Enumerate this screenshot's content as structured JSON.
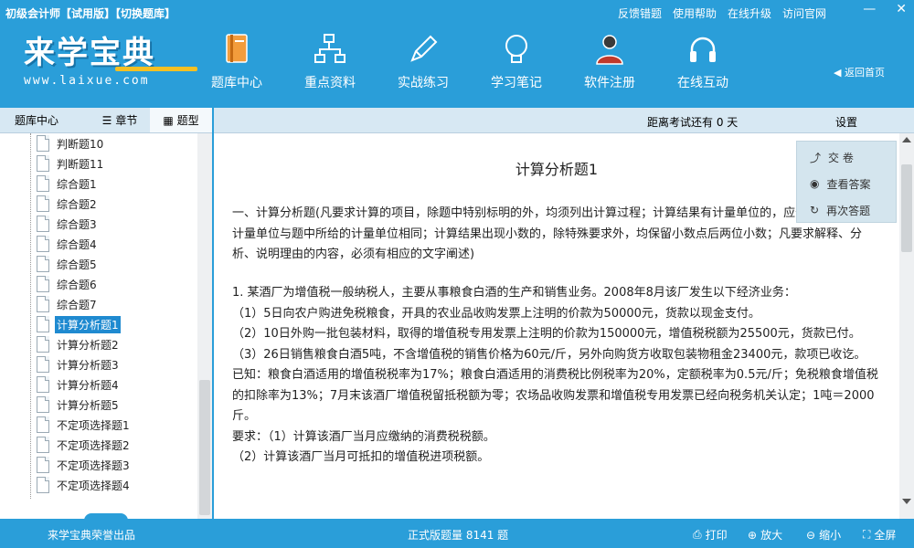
{
  "app": {
    "title": "初级会计师【试用版】【切换题库】"
  },
  "top_links": [
    "反馈错题",
    "使用帮助",
    "在线升级",
    "访问官网"
  ],
  "window_controls": {
    "minimize": "—",
    "close": "✕"
  },
  "logo": {
    "main": "来学宝典",
    "sub": "www.laixue.com"
  },
  "nav": [
    {
      "label": "题库中心",
      "icon": "book-icon"
    },
    {
      "label": "重点资料",
      "icon": "network-icon"
    },
    {
      "label": "实战练习",
      "icon": "pencil-icon"
    },
    {
      "label": "学习笔记",
      "icon": "lightbulb-icon"
    },
    {
      "label": "软件注册",
      "icon": "user-icon"
    },
    {
      "label": "在线互动",
      "icon": "headphones-icon"
    }
  ],
  "back_home": "返回首页",
  "left_tabs": {
    "bank": "题库中心",
    "chapter": "章节",
    "type": "题型"
  },
  "tree_items": [
    "判断题10",
    "判断题11",
    "综合题1",
    "综合题2",
    "综合题3",
    "综合题4",
    "综合题5",
    "综合题6",
    "综合题7",
    "计算分析题1",
    "计算分析题2",
    "计算分析题3",
    "计算分析题4",
    "计算分析题5",
    "不定项选择题1",
    "不定项选择题2",
    "不定项选择题3",
    "不定项选择题4"
  ],
  "selected_tree_item": "计算分析题1",
  "countdown": "距离考试还有 0 天",
  "settings": "设置",
  "question": {
    "title": "计算分析题1",
    "instructions": "一、计算分析题(凡要求计算的项目，除题中特别标明的外，均须列出计算过程；计算结果有计量单位的，应予标明，标明的计量单位与题中所给的计量单位相同；计算结果出现小数的，除特殊要求外，均保留小数点后两位小数；凡要求解释、分析、说明理由的内容，必须有相应的文字阐述)",
    "body": [
      "1. 某酒厂为增值税一般纳税人，主要从事粮食白酒的生产和销售业务。2008年8月该厂发生以下经济业务：",
      "（1）5日向农户购进免税粮食，开具的农业品收购发票上注明的价款为50000元，货款以现金支付。",
      "（2）10日外购一批包装材料，取得的增值税专用发票上注明的价款为150000元，增值税税额为25500元，货款已付。",
      "（3）26日销售粮食白酒5吨，不含增值税的销售价格为60元/斤，另外向购货方收取包装物租金23400元，款项已收讫。",
      "已知：粮食白酒适用的增值税税率为17%；粮食白酒适用的消费税比例税率为20%，定额税率为0.5元/斤；免税粮食增值税的扣除率为13%；7月末该酒厂增值税留抵税额为零；农场品收购发票和增值税专用发票已经向税务机关认定；1吨＝2000斤。",
      "要求：（1）计算该酒厂当月应缴纳的消费税税额。",
      "（2）计算该酒厂当月可抵扣的增值税进项税额。"
    ]
  },
  "float_panel": {
    "submit": "交    卷",
    "view_answer": "查看答案",
    "redo": "再次答题"
  },
  "footer": {
    "brand": "来学宝典荣誉出品",
    "total": "正式版题量 8141 题",
    "print": "打印",
    "zoom_in": "放大",
    "zoom_out": "缩小",
    "fullscreen": "全屏"
  },
  "colors": {
    "primary": "#2a9ed9",
    "selected": "#1f8ad0",
    "accent": "#f5c023"
  }
}
